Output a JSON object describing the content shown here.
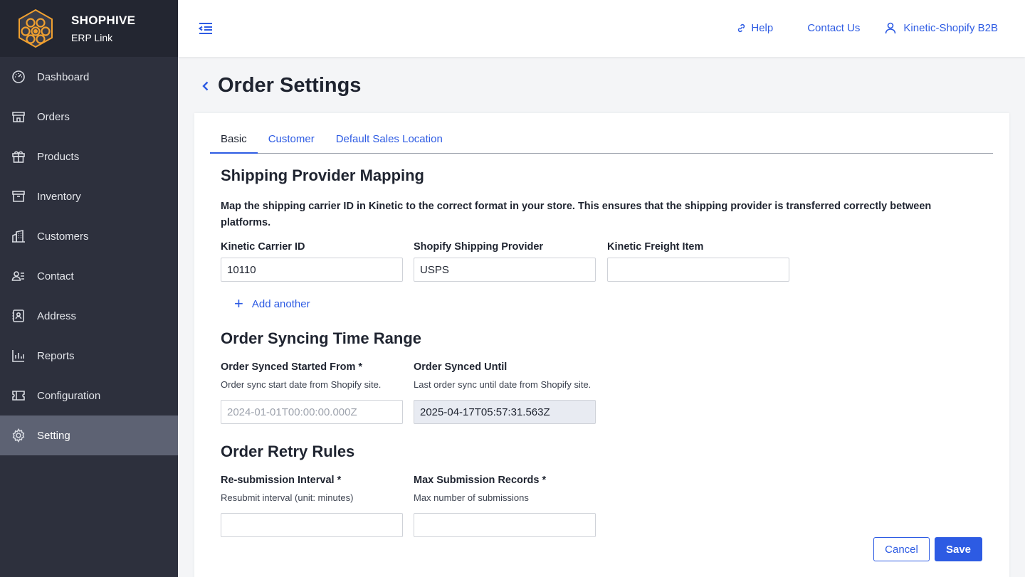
{
  "brand": {
    "name": "SHOPHIVE",
    "subtitle": "ERP Link",
    "logo_icon": "hexagon-honeycomb-logo",
    "accent": "#f0a030"
  },
  "sidebar": {
    "items": [
      {
        "label": "Dashboard",
        "icon": "gauge-icon"
      },
      {
        "label": "Orders",
        "icon": "store-icon"
      },
      {
        "label": "Products",
        "icon": "gift-icon"
      },
      {
        "label": "Inventory",
        "icon": "archive-icon"
      },
      {
        "label": "Customers",
        "icon": "buildings-icon"
      },
      {
        "label": "Contact",
        "icon": "contact-list-icon"
      },
      {
        "label": "Address",
        "icon": "address-book-icon"
      },
      {
        "label": "Reports",
        "icon": "bar-chart-icon"
      },
      {
        "label": "Configuration",
        "icon": "ticket-icon"
      },
      {
        "label": "Setting",
        "icon": "gear-icon",
        "active": true
      }
    ]
  },
  "header": {
    "help_label": "Help",
    "contact_label": "Contact Us",
    "user_label": "Kinetic-Shopify B2B"
  },
  "page": {
    "title": "Order Settings"
  },
  "tabs": [
    {
      "label": "Basic",
      "active": true
    },
    {
      "label": "Customer"
    },
    {
      "label": "Default Sales Location"
    }
  ],
  "shipping": {
    "title": "Shipping Provider Mapping",
    "description": "Map the shipping carrier ID in Kinetic to the correct format in your store. This ensures that the shipping provider is transferred correctly between platforms.",
    "carrier_label": "Kinetic Carrier ID",
    "carrier_value": "10110",
    "provider_label": "Shopify Shipping Provider",
    "provider_value": "USPS",
    "freight_label": "Kinetic Freight Item",
    "freight_value": "",
    "add_another": "Add another"
  },
  "sync": {
    "title": "Order Syncing Time Range",
    "start_label": "Order Synced Started From *",
    "start_hint": "Order sync start date from Shopify site.",
    "start_placeholder": "2024-01-01T00:00:00.000Z",
    "until_label": "Order Synced Until",
    "until_hint": "Last order sync until date from Shopify site.",
    "until_value": "2025-04-17T05:57:31.563Z"
  },
  "retry": {
    "title": "Order Retry Rules",
    "interval_label": "Re-submission Interval *",
    "interval_hint": "Resubmit interval (unit: minutes)",
    "interval_value": "",
    "max_label": "Max Submission Records *",
    "max_hint": "Max number of submissions",
    "max_value": ""
  },
  "actions": {
    "cancel": "Cancel",
    "save": "Save"
  },
  "colors": {
    "primary": "#2d5be3",
    "sidebar_bg": "#2d303d",
    "sidebar_active": "#5d6273"
  }
}
